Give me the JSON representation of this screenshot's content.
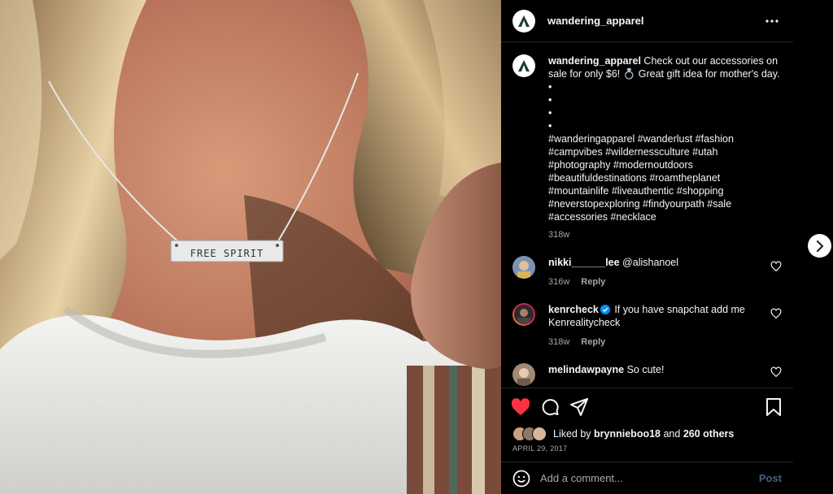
{
  "post": {
    "username": "wandering_apparel",
    "pendant_text": "FREE SPIRIT",
    "caption": {
      "username": "wandering_apparel",
      "text_line1": " Check out our accessories on sale for only $6! 💍 Great gift idea for mother's day. •",
      "dots": [
        "•",
        "•",
        "•"
      ],
      "hashtags": "#wanderingapparel #wanderlust #fashion #campvibes #wildernessculture #utah #photography #modernoutdoors #beautifuldestinations #roamtheplanet #mountainlife #liveauthentic #shopping #neverstopexploring #findyourpath #sale #accessories #necklace",
      "age": "318w"
    },
    "comments": [
      {
        "username": "nikki______lee",
        "text": " @alishanoel",
        "age": "316w",
        "reply_label": "Reply",
        "avatar_color": "#5a6f8a",
        "verified": false
      },
      {
        "username": "kenrcheck",
        "text": " If you have snapchat add me Kenrealitycheck",
        "age": "318w",
        "reply_label": "Reply",
        "avatar_color": "#c13584",
        "verified": true
      },
      {
        "username": "melindawpayne",
        "text": " So cute!",
        "age": "",
        "reply_label": "",
        "avatar_color": "#a08a74",
        "verified": false
      }
    ],
    "likes": {
      "prefix": "Liked by ",
      "user": "brynnieboo18",
      "mid": " and ",
      "others": "260 others"
    },
    "date": "April 29, 2017",
    "add_comment": {
      "placeholder": "Add a comment...",
      "post_label": "Post"
    },
    "colors": {
      "like_red": "#ff3040",
      "post_blue": "#4b5d7c",
      "verified_blue": "#0095f6",
      "border": "#262626"
    }
  },
  "icons": {
    "more": "more-options-icon",
    "like": "heart-filled-icon",
    "comment": "comment-icon",
    "share": "share-icon",
    "save": "bookmark-icon",
    "emoji": "emoji-icon",
    "next": "chevron-right-icon"
  }
}
